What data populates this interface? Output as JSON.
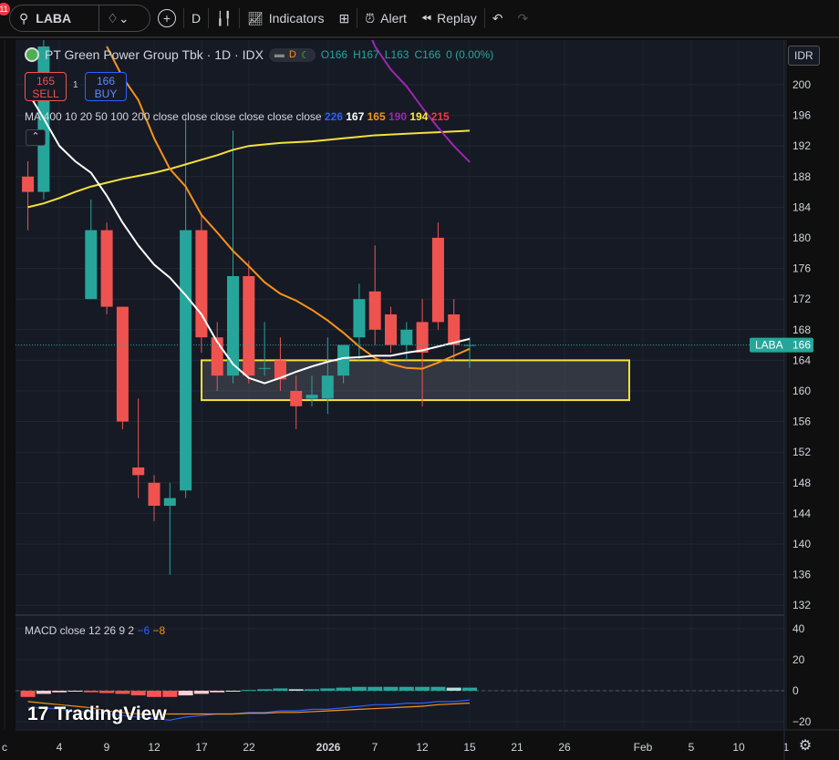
{
  "toolbar": {
    "notification_count": "11",
    "symbol": "LABA",
    "interval": "D",
    "indicators": "Indicators",
    "alert": "Alert",
    "replay": "Replay"
  },
  "legend": {
    "title": "PT Green Power Group Tbk · 1D · IDX",
    "status_d": "D",
    "open": "O166",
    "high": "H167",
    "low": "L163",
    "close": "C166",
    "change": "0 (0.00%)"
  },
  "trade": {
    "sell_price": "165",
    "sell_label": "SELL",
    "qty": "1",
    "buy_price": "166",
    "buy_label": "BUY"
  },
  "ma_legend": {
    "label": "MA 400 10 20 50 100 200 close close close close close close",
    "values": [
      "226",
      "167",
      "165",
      "190",
      "194",
      "215"
    ],
    "colors": [
      "#2962ff",
      "#ffffff",
      "#f7931a",
      "#9c27b0",
      "#ffeb3b",
      "#f23645"
    ]
  },
  "macd_legend": {
    "label": "MACD close 12 26 9",
    "hist": "2",
    "macd": "−6",
    "signal": "−8"
  },
  "currency": "IDR",
  "price_label": {
    "symbol": "LABA",
    "price": "166"
  },
  "watermark": "TradingView",
  "colors": {
    "up": "#26a69a",
    "down": "#ef5350",
    "bg": "#161a25",
    "box": "#f5e13a"
  },
  "chart_data": {
    "type": "candlestick",
    "price_ticks": [
      200,
      196,
      192,
      188,
      184,
      180,
      176,
      172,
      168,
      164,
      160,
      156,
      152,
      148,
      144,
      140,
      136,
      132
    ],
    "macd_ticks": [
      40,
      20,
      0,
      -20
    ],
    "time_labels": [
      "c",
      "4",
      "9",
      "12",
      "17",
      "22",
      "2026",
      "7",
      "12",
      "15",
      "21",
      "26",
      "Feb",
      "5",
      "10",
      "1"
    ],
    "ohlc": [
      [
        188,
        190,
        181,
        186
      ],
      [
        186,
        207,
        185,
        205
      ],
      null,
      null,
      [
        172,
        185,
        172,
        181
      ],
      [
        181,
        182,
        170,
        171
      ],
      [
        171,
        171,
        155,
        156
      ],
      [
        150,
        159,
        146,
        149
      ],
      [
        148,
        149,
        143,
        145
      ],
      [
        145,
        148,
        136,
        146
      ],
      [
        147,
        196,
        146,
        181
      ],
      [
        181,
        183,
        165,
        167
      ],
      [
        167,
        169,
        160,
        162
      ],
      [
        162,
        194,
        161,
        175
      ],
      [
        175,
        177,
        161,
        162
      ],
      [
        163,
        169,
        162,
        163
      ],
      [
        164,
        167,
        160,
        161.5
      ],
      [
        160,
        162,
        155,
        158
      ],
      [
        159,
        162,
        158,
        159.5
      ],
      [
        159,
        167,
        157,
        162
      ],
      [
        162,
        166,
        161,
        166
      ],
      [
        167,
        174,
        164,
        172
      ],
      [
        173,
        179,
        166,
        168
      ],
      [
        170,
        171,
        165,
        166
      ],
      [
        166,
        169,
        164,
        168
      ],
      [
        169,
        172,
        158,
        165
      ],
      [
        180,
        182,
        168,
        169
      ],
      [
        170,
        172,
        164,
        166
      ],
      [
        166,
        167,
        163,
        166
      ]
    ],
    "ma10": [
      199,
      195.6,
      192,
      190,
      188.5,
      185.5,
      182,
      179,
      176.5,
      174.8,
      172.5,
      170,
      166.4,
      163.5,
      161.7,
      161,
      161.7,
      162.5,
      163.2,
      163.8,
      164.3,
      164.4,
      164.6,
      164.6,
      165,
      165.3,
      165.8,
      166.3,
      166.8
    ],
    "ma20": [
      null,
      null,
      null,
      null,
      null,
      205,
      201,
      198,
      193,
      189,
      186.7,
      183,
      180.7,
      178.3,
      176.3,
      174.2,
      172.7,
      171.8,
      170.6,
      169.2,
      167.6,
      165.8,
      164.3,
      163.5,
      163,
      162.9,
      163.7,
      164.6,
      165.5
    ],
    "ma_yellow": [
      184,
      184.5,
      185.2,
      186,
      186.7,
      187.2,
      187.7,
      188.1,
      188.5,
      189,
      189.6,
      190.2,
      190.8,
      191.5,
      192,
      192.2,
      192.4,
      192.5,
      192.6,
      192.8,
      193,
      193.2,
      193.4,
      193.5,
      193.6,
      193.7,
      193.8,
      193.9,
      194
    ],
    "ma_purple": [
      null,
      null,
      null,
      null,
      null,
      null,
      null,
      null,
      null,
      null,
      null,
      null,
      null,
      null,
      null,
      null,
      null,
      null,
      null,
      null,
      null,
      210,
      205,
      202,
      199.8,
      197,
      194.4,
      192,
      189.9
    ],
    "macd_hist": [
      -4,
      -2,
      -1,
      -0.5,
      -1,
      -1.5,
      -2,
      -3,
      -4,
      -4,
      -3,
      -2,
      -1,
      -0.5,
      0.5,
      1,
      1.5,
      1,
      1,
      1.5,
      2,
      2.5,
      2.5,
      2.5,
      2.5,
      2.5,
      2.5,
      2,
      2
    ],
    "macd_line": [
      -11,
      -11,
      -12,
      -13,
      -14,
      -15,
      -16,
      -17,
      -18,
      -19,
      -17,
      -16,
      -15,
      -15,
      -14,
      -14,
      -13,
      -13,
      -12,
      -12,
      -11,
      -10,
      -9,
      -9,
      -8,
      -8,
      -7,
      -7,
      -6
    ],
    "signal_line": [
      -7,
      -8,
      -9,
      -10,
      -11,
      -13,
      -14,
      -15,
      -15,
      -15,
      -15,
      -15,
      -15,
      -15,
      -14.5,
      -14.5,
      -14,
      -14,
      -13.5,
      -13,
      -12.5,
      -12,
      -11.5,
      -11,
      -10.5,
      -10,
      -9,
      -8.5,
      -8
    ],
    "support_zone": [
      158.8,
      164
    ]
  }
}
